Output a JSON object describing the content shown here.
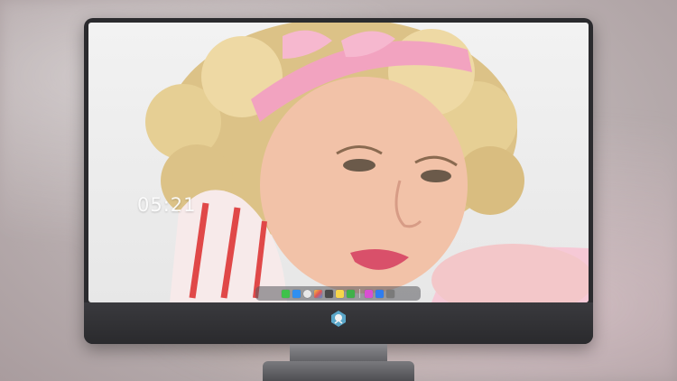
{
  "lock_screen": {
    "time": "05:21",
    "date": ""
  },
  "dock": {
    "apps": [
      {
        "name": "messages-icon",
        "color": "#3ec24b"
      },
      {
        "name": "finder-icon",
        "color": "#2f8ff0"
      },
      {
        "name": "safari-icon",
        "color": "#e8e8e8"
      },
      {
        "name": "photos-icon",
        "color": "#f5c542"
      },
      {
        "name": "clapper-icon",
        "color": "#4a4a4a"
      },
      {
        "name": "notes-icon",
        "color": "#f7d64a"
      },
      {
        "name": "facetime-icon",
        "color": "#40b04a"
      },
      {
        "name": "music-icon",
        "color": "#d94fd1"
      },
      {
        "name": "app-store-icon",
        "color": "#2f7df0"
      },
      {
        "name": "trash-icon",
        "color": "#7a7a7a"
      }
    ]
  },
  "colors": {
    "bezel": "#2b2b2e",
    "headband": "#f2a3c0",
    "hair": "#e9d39a"
  }
}
